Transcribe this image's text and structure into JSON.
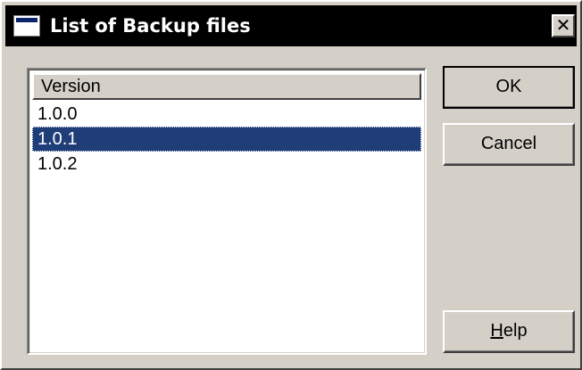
{
  "window": {
    "title": "List of Backup files",
    "close_glyph": "✕",
    "icon": "window-icon"
  },
  "list": {
    "column_header": "Version",
    "rows": [
      {
        "label": "1.0.0",
        "selected": false
      },
      {
        "label": "1.0.1",
        "selected": true
      },
      {
        "label": "1.0.2",
        "selected": false
      }
    ]
  },
  "buttons": {
    "ok_label": "OK",
    "cancel_label": "Cancel",
    "help_mnemonic": "H",
    "help_rest": "elp"
  },
  "colors": {
    "titlebar": "#000000",
    "dialog_face": "#d4d0c8",
    "selection": "#1f3e78"
  }
}
